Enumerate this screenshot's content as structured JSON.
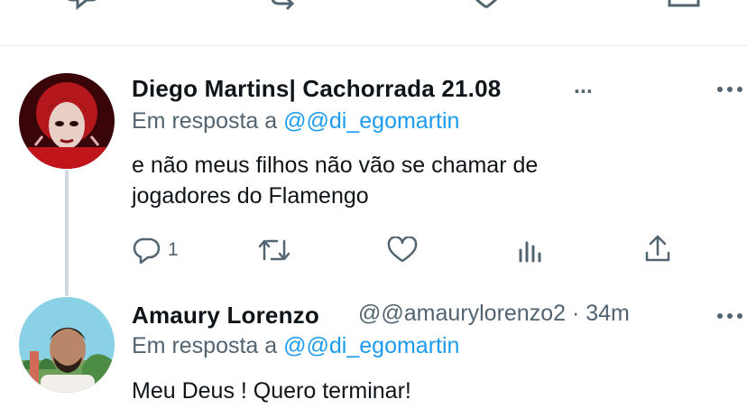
{
  "tweets": [
    {
      "author": "Diego Martins| Cachorrada 21.08",
      "author_more": "...",
      "reply_prefix": "Em resposta a",
      "reply_handle": "@@di_egomartin",
      "text_line1": "e não meus filhos não vão se chamar de",
      "text_line2": "jogadores do Flamengo",
      "reply_count": "1"
    },
    {
      "author": "Amaury Lorenzo",
      "handle_time": "@@amaurylorenzo2 · 34m",
      "reply_prefix": "Em resposta a",
      "reply_handle": "@@di_egomartin",
      "text_line1": "Meu Deus ! Quero terminar!"
    }
  ],
  "colors": {
    "accent": "#1d9bf0",
    "muted": "#536471",
    "divider": "#e6e8eb"
  },
  "icons": [
    "reply-icon",
    "retweet-icon",
    "like-icon",
    "share-icon",
    "views-icon",
    "more-icon"
  ]
}
